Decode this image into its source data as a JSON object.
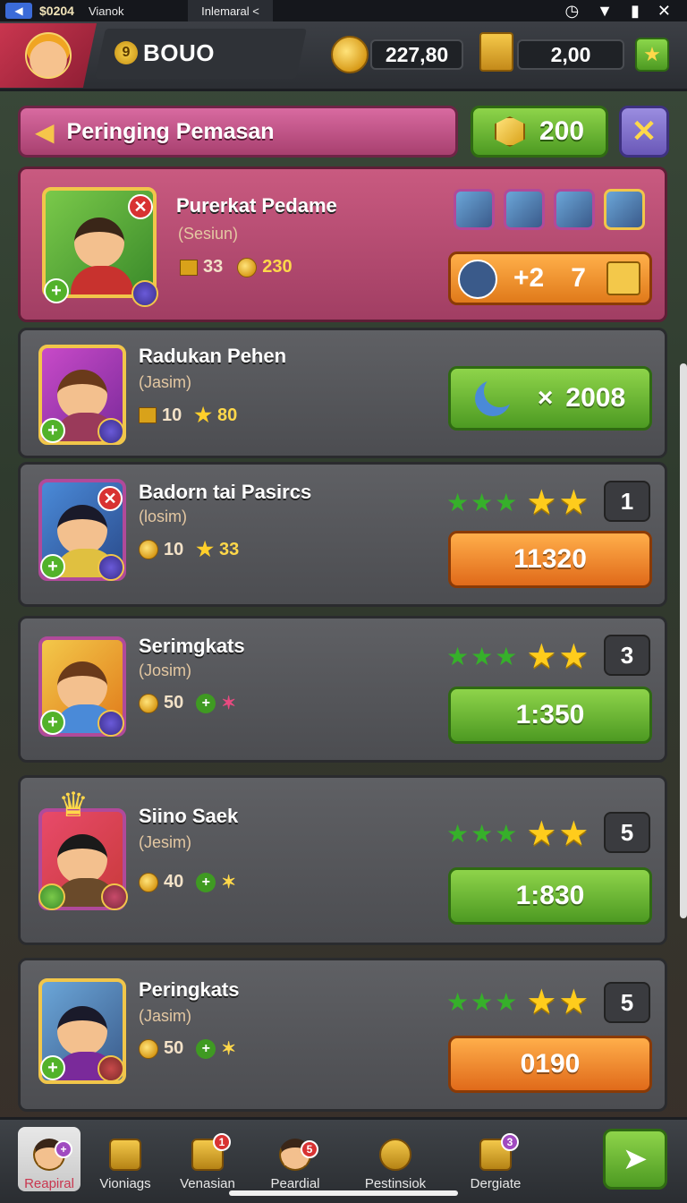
{
  "status_bar": {
    "back_icon": "back-icon",
    "number": "$0204",
    "app_name": "Vianok",
    "tab_label": "Inlemaral <",
    "icons": [
      "clock-icon",
      "wifi-icon",
      "battery-icon",
      "close-icon"
    ]
  },
  "header": {
    "badge_number": "9",
    "title": "BOUO",
    "coins": "227,80",
    "gold": "2,00",
    "add_icon": "star-icon"
  },
  "event": {
    "label": "Peringing Pemasan",
    "gems": "200",
    "close_icon": "x-icon"
  },
  "featured": {
    "name": "Purerkat Pedame",
    "sub": "(Sesiun)",
    "stat_box": "33",
    "stat_coin": "230",
    "reward_plus": "+2",
    "reward_count": "7"
  },
  "cards": [
    {
      "name": "Radukan Pehen",
      "sub": "(Jasim)",
      "stat1": "10",
      "stat2": "80",
      "action": "2008",
      "action_prefix": "×",
      "action_color": "green",
      "rank": ""
    },
    {
      "name": "Badorn tai Pasircs",
      "sub": "(losim)",
      "stat1": "10",
      "stat2": "33",
      "action": "11320",
      "action_color": "orange",
      "rank": "1"
    },
    {
      "name": "Serimgkats",
      "sub": "(Josim)",
      "stat1": "50",
      "stat2": "",
      "action": "1:350",
      "action_color": "green",
      "rank": "3"
    },
    {
      "name": "Siino Saek",
      "sub": "(Jesim)",
      "stat1": "40",
      "stat2": "",
      "action": "1:830",
      "action_color": "green",
      "rank": "5"
    },
    {
      "name": "Peringkats",
      "sub": "(Jasim)",
      "stat1": "50",
      "stat2": "",
      "action": "0190",
      "action_color": "orange",
      "rank": "5"
    }
  ],
  "bottom_nav": [
    {
      "label": "Reapiral",
      "badge": "",
      "active": true
    },
    {
      "label": "Vioniags",
      "badge": ""
    },
    {
      "label": "Venasian",
      "badge": "1"
    },
    {
      "label": "Peardial",
      "badge": "5"
    },
    {
      "label": "Pestinsiok",
      "badge": ""
    },
    {
      "label": "Dergiate",
      "badge": "3"
    }
  ],
  "colors": {
    "accent_green": "#4d9a22",
    "accent_orange": "#e06a1a",
    "featured_pink": "#c95a80",
    "gold": "#f1c64a"
  }
}
